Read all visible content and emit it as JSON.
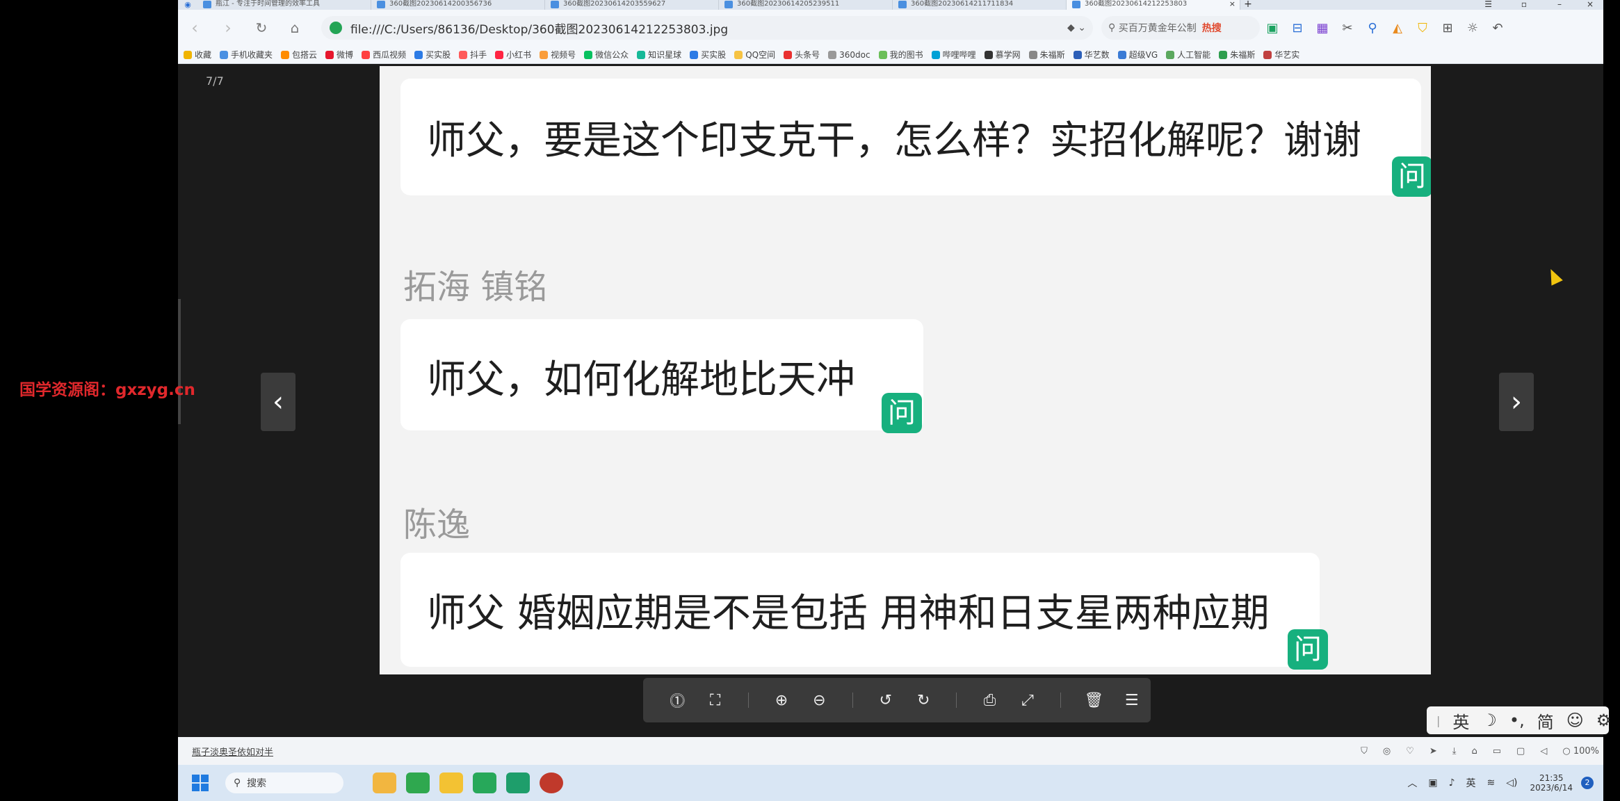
{
  "tabs": [
    {
      "label": "瓶江 - 专注于时间管理的效率工具"
    },
    {
      "label": "360截图20230614200356736"
    },
    {
      "label": "360截图20230614203559627"
    },
    {
      "label": "360截图20230614205239511"
    },
    {
      "label": "360截图20230614211711834"
    },
    {
      "label": "360截图20230614212253803",
      "close": "×"
    }
  ],
  "newtab": "+",
  "address": {
    "url": "file:///C:/Users/86136/Desktop/360截图20230614212253803.jpg"
  },
  "search": {
    "text": "买百万黄金年公制",
    "hot": "热搜"
  },
  "bookmarks": [
    {
      "label": "收藏",
      "color": "#f0b400"
    },
    {
      "label": "手机收藏夹",
      "color": "#4a90e2"
    },
    {
      "label": "包搭云",
      "color": "#ff8c00"
    },
    {
      "label": "微博",
      "color": "#e6162d"
    },
    {
      "label": "西瓜视频",
      "color": "#ff4040"
    },
    {
      "label": "买实股",
      "color": "#2c7be5"
    },
    {
      "label": "抖手",
      "color": "#ff5a5a"
    },
    {
      "label": "小红书",
      "color": "#ff2442"
    },
    {
      "label": "视频号",
      "color": "#fa9d3b"
    },
    {
      "label": "微信公众",
      "color": "#07c160"
    },
    {
      "label": "知识星球",
      "color": "#16b998"
    },
    {
      "label": "买实股",
      "color": "#2c7be5"
    },
    {
      "label": "QQ空间",
      "color": "#f6c343"
    },
    {
      "label": "头条号",
      "color": "#e93030"
    },
    {
      "label": "360doc",
      "color": "#999999"
    },
    {
      "label": "我的图书",
      "color": "#6bbf59"
    },
    {
      "label": "哔哩哔哩",
      "color": "#00a1d6"
    },
    {
      "label": "慕学网",
      "color": "#333333"
    },
    {
      "label": "朱福斯",
      "color": "#888888"
    },
    {
      "label": "华艺数",
      "color": "#2c5fb8"
    },
    {
      "label": "超级VG",
      "color": "#3a7bd5"
    },
    {
      "label": "人工智能",
      "color": "#5ba85f"
    },
    {
      "label": "朱福斯",
      "color": "#2e9e4f"
    },
    {
      "label": "华艺实",
      "color": "#c04040"
    }
  ],
  "viewer": {
    "counter": "7/7",
    "prev": "‹",
    "next": "›",
    "messages": [
      {
        "sender": "",
        "text": "师父，要是这个印支克干，怎么样？实招化解呢？谢谢",
        "badge": "问"
      },
      {
        "sender": "拓海 镇铭",
        "text": "师父，如何化解地比天冲",
        "badge": "问"
      },
      {
        "sender": "陈逸",
        "text": "师父 婚姻应期是不是包括 用神和日支星两种应期",
        "badge": "问"
      }
    ]
  },
  "status": {
    "link": "瓶子淡奥圣依如对半",
    "zoom": "100%"
  },
  "taskbar": {
    "search": "搜索",
    "time": "21:35",
    "date": "2023/6/14",
    "lang": "英",
    "badge": "2"
  },
  "ime": {
    "mode": "英",
    "simp": "简"
  },
  "watermark": "国学资源阁：gxzyg.cn"
}
